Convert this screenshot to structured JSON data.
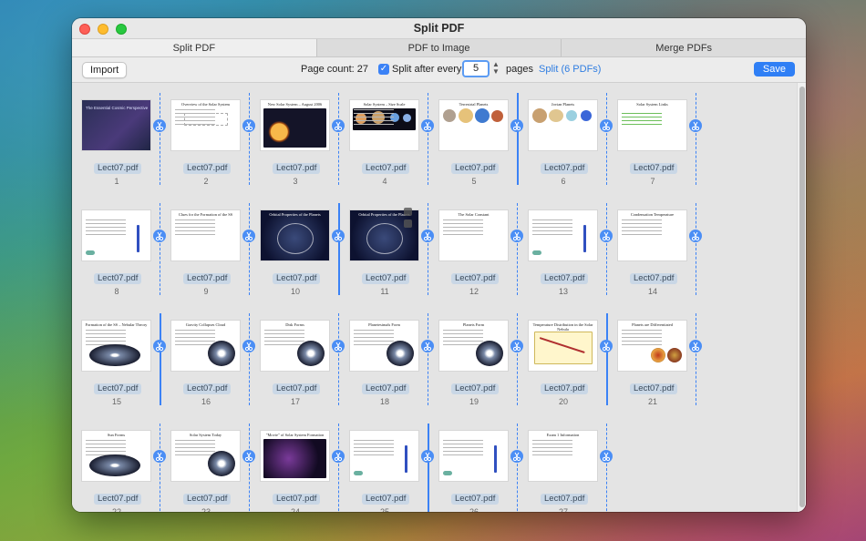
{
  "window": {
    "title": "Split PDF"
  },
  "tabs": [
    {
      "label": "Split PDF",
      "active": true
    },
    {
      "label": "PDF to Image",
      "active": false
    },
    {
      "label": "Merge PDFs",
      "active": false
    }
  ],
  "toolbar": {
    "import_label": "Import",
    "page_count": "Page count: 27",
    "split_after_label": "Split after every",
    "split_after_checked": true,
    "split_every_value": "5",
    "pages_label": "pages",
    "split_link": "Split (6 PDFs)",
    "save_label": "Save"
  },
  "pages": [
    {
      "n": "1",
      "file": "Lect07.pdf",
      "title": "The Essential Cosmic Perspective",
      "style": "cover"
    },
    {
      "n": "2",
      "file": "Lect07.pdf",
      "title": "Overview of the Solar System",
      "style": "diagram"
    },
    {
      "n": "3",
      "file": "Lect07.pdf",
      "title": "New Solar System – August 2006",
      "style": "planets-dark"
    },
    {
      "n": "4",
      "file": "Lect07.pdf",
      "title": "Solar System – Size Scale",
      "style": "planets-row"
    },
    {
      "n": "5",
      "file": "Lect07.pdf",
      "title": "Terrestrial Planets",
      "style": "terrestrial"
    },
    {
      "n": "6",
      "file": "Lect07.pdf",
      "title": "Jovian Planets",
      "style": "jovian"
    },
    {
      "n": "7",
      "file": "Lect07.pdf",
      "title": "Solar System Links",
      "style": "links"
    },
    {
      "n": "8",
      "file": "Lect07.pdf",
      "title": "",
      "style": "quiz"
    },
    {
      "n": "9",
      "file": "Lect07.pdf",
      "title": "Clues for the Formation of the SS",
      "style": "text"
    },
    {
      "n": "10",
      "file": "Lect07.pdf",
      "title": "Orbital Properties of the Planets",
      "style": "orbit"
    },
    {
      "n": "11",
      "file": "Lect07.pdf",
      "title": "Orbital Properties of the Planets",
      "style": "orbit"
    },
    {
      "n": "12",
      "file": "Lect07.pdf",
      "title": "The Solar Constant",
      "style": "text"
    },
    {
      "n": "13",
      "file": "Lect07.pdf",
      "title": "",
      "style": "quiz"
    },
    {
      "n": "14",
      "file": "Lect07.pdf",
      "title": "Condensation Temperature",
      "style": "text"
    },
    {
      "n": "15",
      "file": "Lect07.pdf",
      "title": "Formation of the SS – Nebular Theory",
      "style": "galaxy"
    },
    {
      "n": "16",
      "file": "Lect07.pdf",
      "title": "Gravity Collapses Cloud",
      "style": "nebula"
    },
    {
      "n": "17",
      "file": "Lect07.pdf",
      "title": "Disk Forms",
      "style": "disk"
    },
    {
      "n": "18",
      "file": "Lect07.pdf",
      "title": "Planetesimals Form",
      "style": "disk"
    },
    {
      "n": "19",
      "file": "Lect07.pdf",
      "title": "Planets Form",
      "style": "disk"
    },
    {
      "n": "20",
      "file": "Lect07.pdf",
      "title": "Temperature Distribution in the Solar Nebula",
      "style": "chart"
    },
    {
      "n": "21",
      "file": "Lect07.pdf",
      "title": "Planets are Differentiated",
      "style": "diff"
    },
    {
      "n": "22",
      "file": "Lect07.pdf",
      "title": "Sun Forms",
      "style": "galaxy"
    },
    {
      "n": "23",
      "file": "Lect07.pdf",
      "title": "Solar System Today",
      "style": "disk"
    },
    {
      "n": "24",
      "file": "Lect07.pdf",
      "title": "\"Movie\" of Solar System Formation",
      "style": "movie"
    },
    {
      "n": "25",
      "file": "Lect07.pdf",
      "title": "",
      "style": "quiz"
    },
    {
      "n": "26",
      "file": "Lect07.pdf",
      "title": "",
      "style": "quiz"
    },
    {
      "n": "27",
      "file": "Lect07.pdf",
      "title": "Exam 1 Information",
      "style": "text"
    }
  ],
  "colors": {
    "accent": "#3b82f6",
    "badge": "#c9d7e6"
  }
}
